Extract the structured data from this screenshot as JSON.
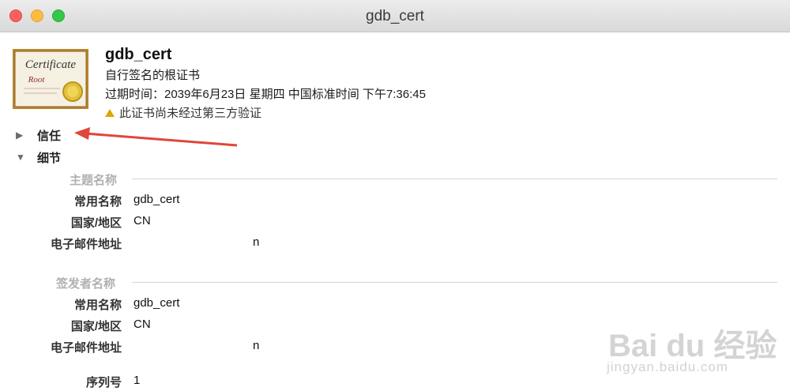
{
  "window": {
    "title": "gdb_cert"
  },
  "header": {
    "name": "gdb_cert",
    "subtitle": "自行签名的根证书",
    "expiry": "过期时间：2039年6月23日 星期四 中国标准时间 下午7:36:45",
    "warning": "此证书尚未经过第三方验证",
    "icon_text": {
      "line1": "Certificate",
      "line2": "Root"
    }
  },
  "sections": {
    "trust": "信任",
    "details": "细节"
  },
  "subject": {
    "heading": "主题名称",
    "common_name_label": "常用名称",
    "common_name": "gdb_cert",
    "country_label": "国家/地区",
    "country": "CN",
    "email_label": "电子邮件地址",
    "email_visible": "n"
  },
  "issuer": {
    "heading": "签发者名称",
    "common_name_label": "常用名称",
    "common_name": "gdb_cert",
    "country_label": "国家/地区",
    "country": "CN",
    "email_label": "电子邮件地址",
    "email_visible": "n"
  },
  "serial": {
    "label": "序列号",
    "value": "1"
  },
  "watermark": {
    "brand": "Bai du 经验",
    "url": "jingyan.baidu.com"
  },
  "colors": {
    "annotation_arrow": "#e0463a",
    "warning": "#d9a800",
    "group_heading": "#b0b0b0"
  }
}
